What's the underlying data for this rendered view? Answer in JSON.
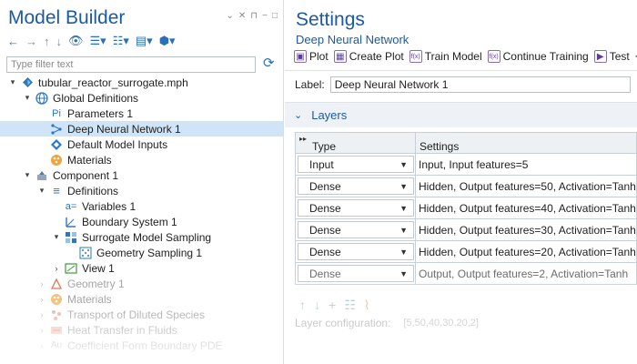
{
  "model_builder": {
    "title": "Model Builder",
    "filter_placeholder": "Type filter text",
    "tree": [
      {
        "label": "tubular_reactor_surrogate.mph",
        "icon": "model-file-icon"
      },
      {
        "label": "Global Definitions",
        "icon": "globe-icon"
      },
      {
        "label": "Parameters 1",
        "icon": "parameters-icon",
        "glyph": "Pi"
      },
      {
        "label": "Deep Neural Network 1",
        "icon": "neural-network-icon",
        "selected": true
      },
      {
        "label": "Default Model Inputs",
        "icon": "model-inputs-icon"
      },
      {
        "label": "Materials",
        "icon": "materials-icon"
      },
      {
        "label": "Component 1",
        "icon": "component-icon"
      },
      {
        "label": "Definitions",
        "icon": "definitions-icon",
        "glyph": "≡"
      },
      {
        "label": "Variables 1",
        "icon": "variables-icon",
        "glyph": "a="
      },
      {
        "label": "Boundary System 1",
        "icon": "boundary-system-icon"
      },
      {
        "label": "Surrogate Model Sampling",
        "icon": "sampling-icon"
      },
      {
        "label": "Geometry Sampling 1",
        "icon": "geometry-sampling-icon"
      },
      {
        "label": "View 1",
        "icon": "view-icon"
      },
      {
        "label": "Geometry 1",
        "icon": "geometry-icon"
      },
      {
        "label": "Materials",
        "icon": "materials-icon"
      },
      {
        "label": "Transport of Diluted Species",
        "icon": "transport-icon"
      },
      {
        "label": "Heat Transfer in Fluids",
        "icon": "heat-transfer-icon"
      },
      {
        "label": "Coefficient Form Boundary PDE",
        "icon": "pde-icon",
        "glyph": "Au"
      }
    ]
  },
  "settings": {
    "title": "Settings",
    "subtitle": "Deep Neural Network",
    "toolbar": [
      "Plot",
      "Create Plot",
      "Train Model",
      "Continue Training",
      "Test"
    ],
    "label_caption": "Label:",
    "label_value": "Deep Neural Network 1",
    "section_title": "Layers",
    "table_headers": {
      "type": "Type",
      "settings": "Settings"
    },
    "layers": [
      {
        "type": "Input",
        "settings": "Input, Input features=5"
      },
      {
        "type": "Dense",
        "settings": "Hidden, Output features=50, Activation=Tanh"
      },
      {
        "type": "Dense",
        "settings": "Hidden, Output features=40, Activation=Tanh"
      },
      {
        "type": "Dense",
        "settings": "Hidden, Output features=30, Activation=Tanh"
      },
      {
        "type": "Dense",
        "settings": "Hidden, Output features=20, Activation=Tanh"
      },
      {
        "type": "Dense",
        "settings": "Output, Output features=2, Activation=Tanh"
      }
    ],
    "layer_config_label": "Layer configuration:",
    "layer_config_value": "[5,50,40,30,20,2]"
  },
  "colors": {
    "accent": "#1a5aa6",
    "selection": "#cfe5f7"
  }
}
